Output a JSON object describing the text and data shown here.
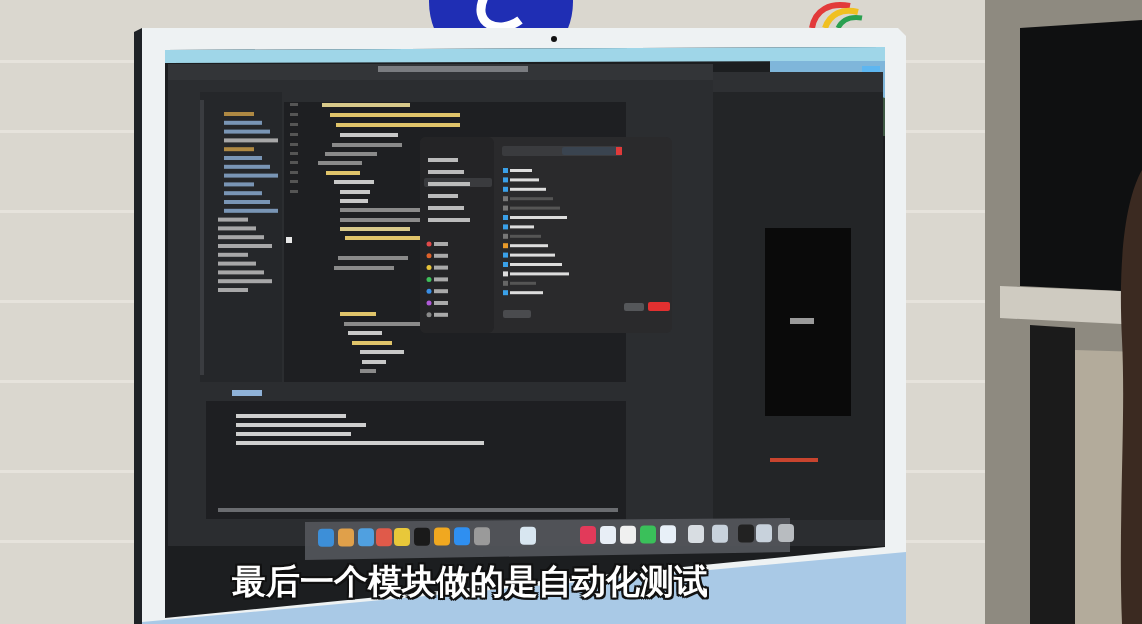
{
  "video": {
    "subtitle": "最后一个模块做的是自动化测试"
  }
}
